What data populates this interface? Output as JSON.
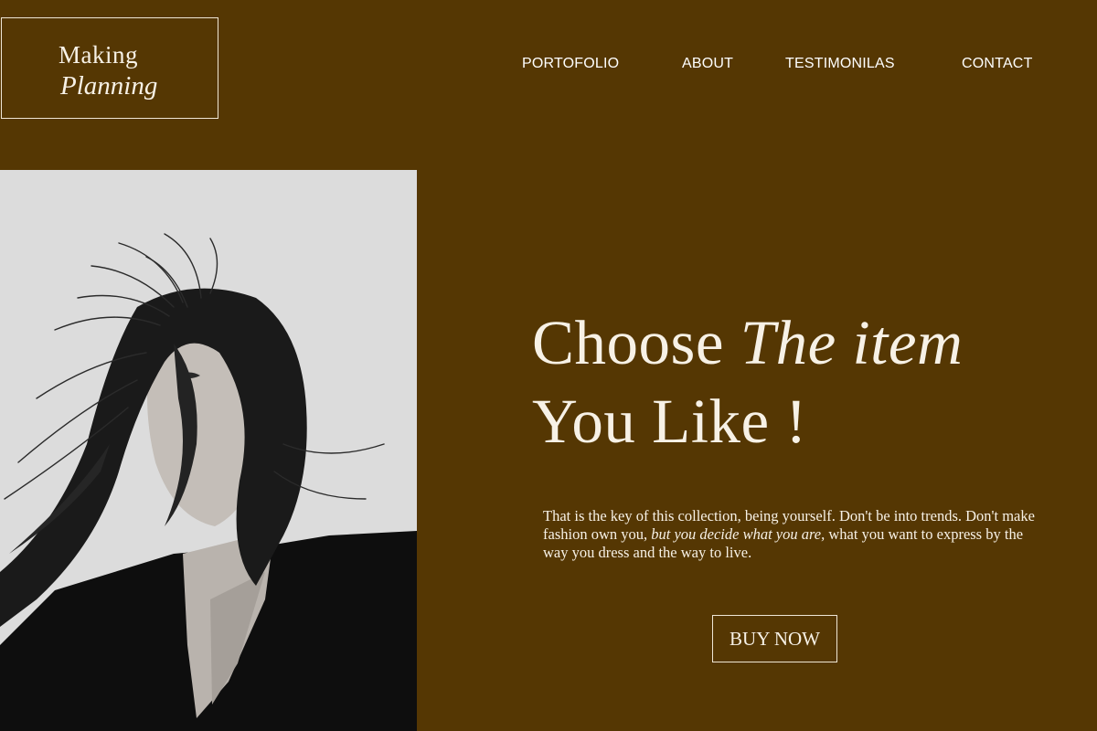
{
  "brand": {
    "line1": "Making",
    "line2": "Planning"
  },
  "nav": [
    {
      "label": "PORTOFOLIO"
    },
    {
      "label": "ABOUT"
    },
    {
      "label": "TESTIMONILAS"
    },
    {
      "label": "CONTACT"
    }
  ],
  "hero": {
    "headline_part1": "Choose ",
    "headline_part2": "The item",
    "headline_line2": "You Like !",
    "paragraph_part1": "That is the key of this collection, being yourself. Don't be into trends. Don't make fashion own you, ",
    "paragraph_italic": "but you decide what you are,",
    "paragraph_part2": " what you want to express by the way you dress and the way to live.",
    "button_label": "BUY NOW"
  },
  "colors": {
    "background": "#553703",
    "text": "#f7f1e6",
    "photo_background": "#dcdcdc"
  }
}
